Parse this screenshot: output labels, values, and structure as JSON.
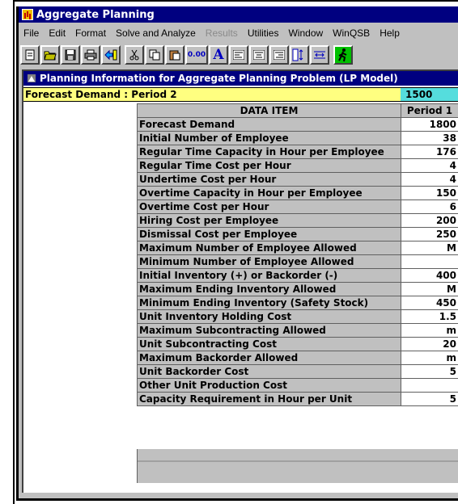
{
  "app": {
    "title": "Aggregate Planning"
  },
  "menu": [
    "File",
    "Edit",
    "Format",
    "Solve and Analyze",
    "Results",
    "Utilities",
    "Window",
    "WinQSB",
    "Help"
  ],
  "menu_disabled": [
    "Results"
  ],
  "toolbar": {
    "buttons": [
      "new-file-icon",
      "open-folder-icon",
      "save-disk-icon",
      "print-icon",
      "switch-icon",
      "cut-icon",
      "copy-icon",
      "paste-icon",
      "number-format-icon",
      "font-icon",
      "align-left-icon",
      "align-center-icon",
      "align-right-icon",
      "column-width-icon",
      "row-height-icon",
      "solve-run-icon"
    ],
    "number_format_label": "0.00",
    "font_label": "A"
  },
  "sheet": {
    "title": "Planning Information for Aggregate Planning Problem (LP Model)",
    "cell_ref": "Forecast Demand : Period 2",
    "cell_value": "1500",
    "headers": [
      "DATA ITEM",
      "Period 1"
    ],
    "rows": [
      {
        "label": "Forecast Demand",
        "value": "1800"
      },
      {
        "label": "Initial Number of Employee",
        "value": "38"
      },
      {
        "label": "Regular Time Capacity in Hour per Employee",
        "value": "176"
      },
      {
        "label": "Regular Time Cost per Hour",
        "value": "4"
      },
      {
        "label": "Undertime Cost per Hour",
        "value": "4"
      },
      {
        "label": "Overtime Capacity in Hour per Employee",
        "value": "150"
      },
      {
        "label": "Overtime Cost per Hour",
        "value": "6"
      },
      {
        "label": "Hiring Cost per Employee",
        "value": "200"
      },
      {
        "label": "Dismissal Cost per Employee",
        "value": "250"
      },
      {
        "label": "Maximum Number of Employee Allowed",
        "value": "M"
      },
      {
        "label": "Minimum Number of Employee Allowed",
        "value": ""
      },
      {
        "label": "Initial Inventory (+) or Backorder (-)",
        "value": "400"
      },
      {
        "label": "Maximum Ending Inventory Allowed",
        "value": "M"
      },
      {
        "label": "Minimum Ending Inventory (Safety Stock)",
        "value": "450"
      },
      {
        "label": "Unit Inventory Holding Cost",
        "value": "1.5"
      },
      {
        "label": "Maximum Subcontracting Allowed",
        "value": "m"
      },
      {
        "label": "Unit Subcontracting Cost",
        "value": "20"
      },
      {
        "label": "Maximum Backorder Allowed",
        "value": "m"
      },
      {
        "label": "Unit Backorder Cost",
        "value": "5"
      },
      {
        "label": "Other Unit Production Cost",
        "value": ""
      },
      {
        "label": "Capacity Requirement in Hour per Unit",
        "value": "5"
      }
    ]
  },
  "colors": {
    "titlebar": "#000080",
    "cell_bar": "#ffff80",
    "cell_value_bg": "#55dddd",
    "gray": "#c0c0c0"
  }
}
